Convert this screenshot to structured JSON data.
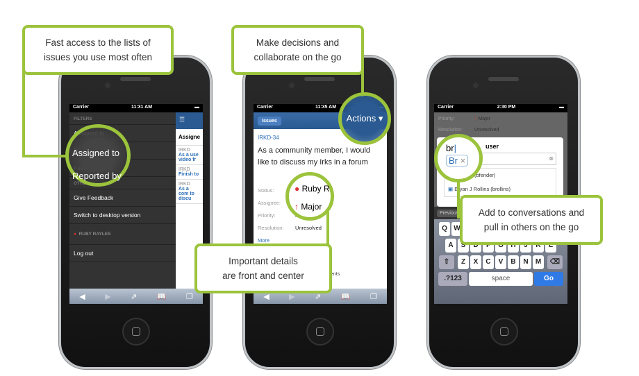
{
  "callouts": {
    "c1": [
      "Fast access to the lists of",
      "issues you use most often"
    ],
    "c2": [
      "Make decisions and",
      "collaborate on the go"
    ],
    "c3": [
      "Important details",
      "are front and center"
    ],
    "c4": [
      "Add to conversations and",
      "pull in others on the go"
    ]
  },
  "phone1": {
    "carrier": "Carrier",
    "time": "11:31 AM",
    "filters_header": "FILTERS",
    "items": [
      "Assigned to",
      "Reported by",
      "Favorite Filters"
    ],
    "other_header": "OTHER",
    "other_items": [
      "Give Feedback",
      "Switch to desktop version"
    ],
    "user": "RUBY RAYLES",
    "logout": "Log out",
    "panel_header": "Assigne",
    "issues": [
      {
        "key": "IRKD",
        "title": "As a use video fr"
      },
      {
        "key": "IRKD",
        "title": "Finish to"
      },
      {
        "key": "IRKD",
        "title": "As a com to discu"
      }
    ]
  },
  "phone2": {
    "carrier": "Carrier",
    "time": "11:35 AM",
    "back": "Issues",
    "actions": "Actions",
    "key": "IRKD-34",
    "summary": "As a community member, I would like to discuss my Irks in a forum",
    "fields": [
      {
        "label": "Status:",
        "value": ""
      },
      {
        "label": "Assignee:",
        "value": "Ruby R"
      },
      {
        "label": "Priority:",
        "value": "Major"
      },
      {
        "label": "Resolution:",
        "value": "Unresolved"
      }
    ],
    "more": "More",
    "comments": "comments"
  },
  "phone3": {
    "carrier": "Carrier",
    "time": "2:30 PM",
    "bg_priority_label": "Priority:",
    "bg_priority": "Major",
    "bg_resolution_label": "Resolution:",
    "bg_resolution": "Unresolved",
    "dialog_title": "user",
    "typed": "br",
    "token": "Br",
    "results": [
      "Brender (bfender)",
      "Bryan J Rollins (brollins)"
    ],
    "prev": "Previous",
    "rows": [
      [
        "Q",
        "W",
        "E",
        "R",
        "T",
        "Y",
        "U",
        "I",
        "O",
        "P"
      ],
      [
        "A",
        "S",
        "D",
        "F",
        "G",
        "H",
        "J",
        "K",
        "L"
      ],
      [
        "Z",
        "X",
        "C",
        "V",
        "B",
        "N",
        "M"
      ]
    ],
    "k123": ".?123",
    "space": "space",
    "go": "Go"
  },
  "colors": {
    "accent": "#9bc33c",
    "link": "#2a6db5",
    "nav": "#2a5a91"
  }
}
